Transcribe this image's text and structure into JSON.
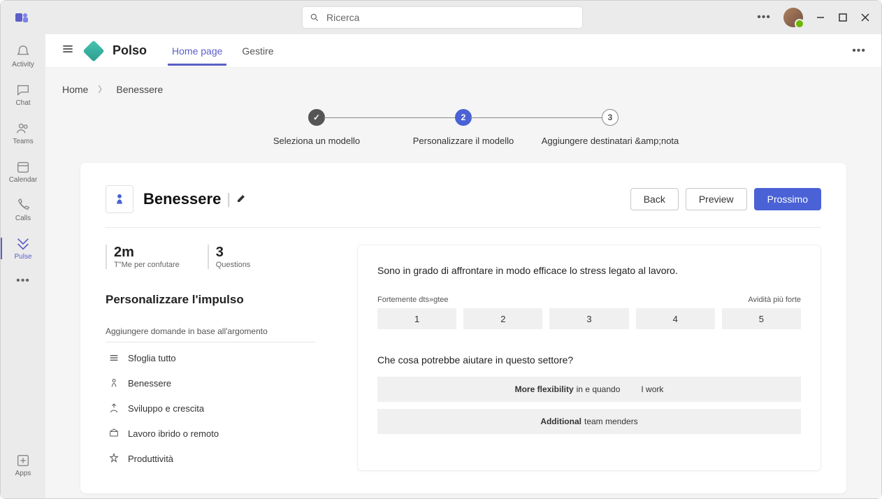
{
  "search": {
    "placeholder": "Ricerca"
  },
  "rail": {
    "activity": "Activity",
    "chat": "Chat",
    "teams": "Teams",
    "calendar": "Calendar",
    "calls": "Calls",
    "pulse": "Pulse",
    "apps": "Apps"
  },
  "app": {
    "name": "Polso",
    "tabs": {
      "home": "Home page",
      "manage": "Gestire"
    }
  },
  "crumbs": {
    "home": "Home",
    "current": "Benessere"
  },
  "stepper": {
    "s1": "Seleziona un modello",
    "s2": "Personalizzare il modello",
    "s2num": "2",
    "s3": "Aggiungere destinatari &amp;nota",
    "s3num": "3"
  },
  "card": {
    "title": "Benessere",
    "back": "Back",
    "preview": "Preview",
    "next": "Prossimo"
  },
  "stats": {
    "time_val": "2m",
    "time_label": "T\"Me per confutare",
    "q_val": "3",
    "q_label": "Questions"
  },
  "left": {
    "heading": "Personalizzare l'impulso",
    "hint": "Aggiungere domande in base all'argomento",
    "topics": {
      "browse": "Sfoglia tutto",
      "wellbeing": "Benessere",
      "development": "Sviluppo e crescita",
      "hybrid": "Lavoro ibrido o remoto",
      "productivity": "Produttività"
    }
  },
  "right": {
    "q1": "Sono in grado di affrontare in modo efficace lo stress legato al lavoro.",
    "scale_left": "Fortemente dts»gtee",
    "scale_right": "Avidità più forte",
    "scale": {
      "v1": "1",
      "v2": "2",
      "v3": "3",
      "v4": "4",
      "v5": "5"
    },
    "q2": "Che cosa potrebbe aiutare in questo settore?",
    "opt1_a": "More flexibility",
    "opt1_b": "in e quando",
    "opt1_c": "I work",
    "opt2_a": "Additional",
    "opt2_b": "team menders"
  }
}
